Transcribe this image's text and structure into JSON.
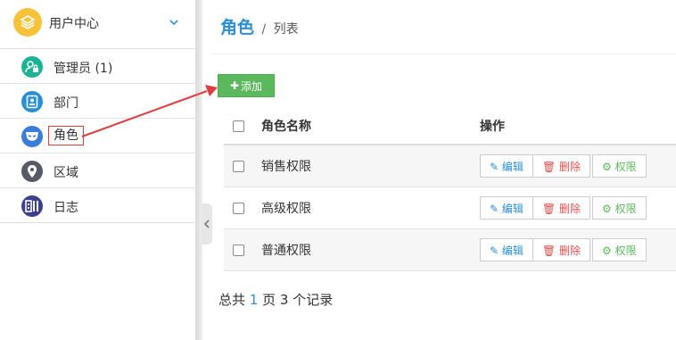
{
  "sidebar": {
    "header": {
      "title": "用户中心"
    },
    "items": [
      {
        "label": "管理员 (1)",
        "icon": "user-lock-icon",
        "color": "#1ab394"
      },
      {
        "label": "部门",
        "icon": "id-card-icon",
        "color": "#2a8fd4"
      },
      {
        "label": "角色",
        "icon": "mask-icon",
        "color": "#3b7ddd"
      },
      {
        "label": "区域",
        "icon": "map-pin-icon",
        "color": "#555a64"
      },
      {
        "label": "日志",
        "icon": "log-icon",
        "color": "#3d3f8f"
      }
    ]
  },
  "breadcrumb": {
    "current": "角色",
    "separator": "/",
    "sub": "列表"
  },
  "toolbar": {
    "add_label": "添加"
  },
  "table": {
    "headers": [
      "角色名称",
      "操作"
    ],
    "rows": [
      {
        "name": "销售权限"
      },
      {
        "name": "高级权限"
      },
      {
        "name": "普通权限"
      }
    ],
    "actions": {
      "edit": "编辑",
      "delete": "删除",
      "permission": "权限"
    }
  },
  "pager": {
    "prefix": "总共",
    "pages": "1",
    "mid": "页",
    "records": "3",
    "suffix": "个记录"
  },
  "colors": {
    "accent": "#2a8fd4",
    "success": "#5cb85c",
    "danger": "#d9534f",
    "annotation": "#e23c3c"
  }
}
